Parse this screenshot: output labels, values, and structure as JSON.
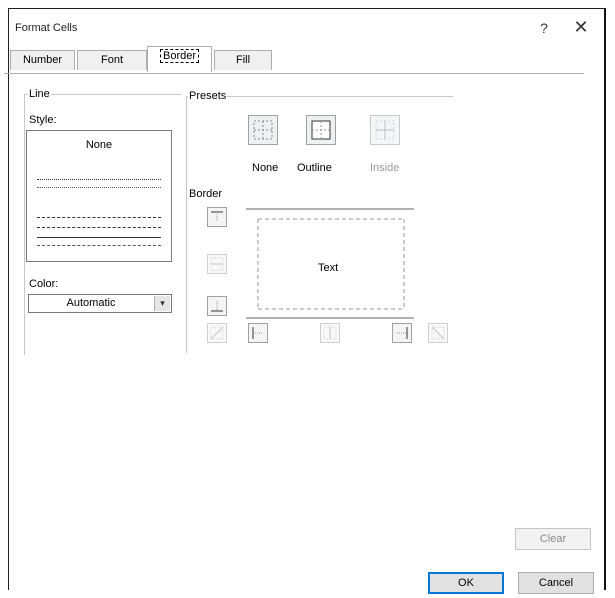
{
  "window": {
    "title": "Format Cells",
    "help": "?",
    "close": "✕"
  },
  "tabs": [
    "Number",
    "Font",
    "Border",
    "Fill"
  ],
  "line_group": {
    "label": "Line",
    "style_label": "Style:",
    "style_none": "None",
    "color_label": "Color:",
    "color_value": "Automatic",
    "dropdown_arrow": "▾"
  },
  "presets": {
    "label": "Presets",
    "items": [
      "None",
      "Outline",
      "Inside"
    ]
  },
  "border": {
    "label": "Border",
    "preview_text": "Text"
  },
  "buttons": {
    "clear": "Clear",
    "ok": "OK",
    "cancel": "Cancel"
  }
}
